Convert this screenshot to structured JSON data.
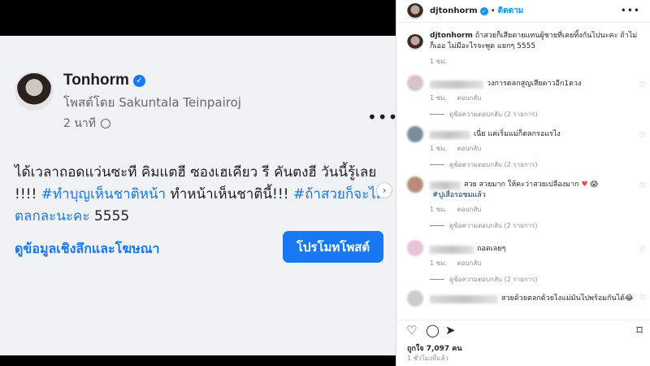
{
  "post": {
    "author": "Tonhorm",
    "posted_by": "โพสต์โดย Sakuntala Teinpairoj",
    "time": "2 นาที",
    "text_plain": "ได้เวลาถอดแว่นซะที คิมแตฮี ซองเฮเคียว รี คันตงฮี วันนี้รู้เลย !!!!",
    "hashtag1": "#ทำบุญเห็นชาติหน้า",
    "text_mid": "ทำหน้าเห็นชาตินี้!!!",
    "hashtag2": "#ถ้าสวยก็จะไม่ตลกละนะคะ",
    "text_end": "5555",
    "insights_label": "ดูข้อมูลเชิงลึกและโฆษณา",
    "promote_label": "โปรโมทโพสต์",
    "more_icon": "•••"
  },
  "sidebar": {
    "username": "djtonhorm",
    "follow_label": "ติดตาม",
    "more_icon": "•••",
    "caption": "ถ้าสวยก็เสียดายแทนผู้ชายที่เคยทิ้งกันไปนะคะ ถ้าไม่ ก็เออ ไม่มีอะไรจะพูด แยกๆ 5555",
    "caption_time": "1 ชม.",
    "comments": [
      {
        "text": "วงการตลกสูญเสียดาวอีก1ดวง",
        "time": "1 ชม.",
        "reply": "ตอบกลับ",
        "view_replies": "ดูข้อความตอบกลับ (2 รายการ)",
        "avatar_color": "#d7c4c4"
      },
      {
        "text": "เนี่ย แค่เริ่มแม่ก็ตลกรอแรไง",
        "time": "1 ชม.",
        "reply": "ตอบกลับ",
        "view_replies": "ดูข้อความตอบกลับ (2 รายการ)",
        "avatar_color": "#7a8c99"
      },
      {
        "text_a": "สวย สวยมาก ให้คะว่าสวยเปลืองมาก",
        "heart": "♥",
        "emoji": "😱",
        "tag": "#ปูเสื่อรอชมแล้ว",
        "time": "1 ชม.",
        "reply": "ตอบกลับ",
        "view_replies": "ดูข้อความตอบกลับ (2 รายการ)",
        "avatar_color": "#b88a7a"
      },
      {
        "text": "ถอดเลยๆ",
        "time": "1 ชม.",
        "reply": "ตอบกลับ",
        "view_replies": "ดูข้อความตอบกลับ (2 รายการ)",
        "avatar_color": "#e6c3d6"
      },
      {
        "text": "สวยด้วยตลกด้วยไงแม่มันไปพร้อมกันได้😂",
        "avatar_color": "#cccccc"
      }
    ],
    "likes": "ถูกใจ 7,097 คน",
    "posted_ago": "1 ชั่วโมงที่แล้ว",
    "icons": {
      "like": "heart-icon",
      "comment": "comment-icon",
      "share": "share-icon",
      "save": "bookmark-icon"
    }
  }
}
